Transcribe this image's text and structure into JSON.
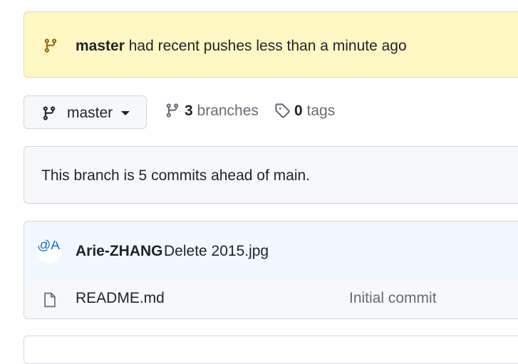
{
  "banner": {
    "branch": "master",
    "message": " had recent pushes less than a minute ago"
  },
  "branch_selector": {
    "label": "master"
  },
  "branches": {
    "count": "3",
    "label": "branches"
  },
  "tags": {
    "count": "0",
    "label": "tags"
  },
  "ahead_notice": {
    "text": "This branch is 5 commits ahead of main."
  },
  "latest_commit": {
    "avatar_text": "@Arie-",
    "author": "Arie-ZHANG",
    "message": "Delete 2015.jpg"
  },
  "files": [
    {
      "name": "README.md",
      "commit_message": "Initial commit"
    }
  ],
  "colors": {
    "banner_bg": "#fff8c5",
    "commit_bg": "#f1f8ff",
    "muted": "#656d76",
    "branch_icon": "#9a6700"
  }
}
